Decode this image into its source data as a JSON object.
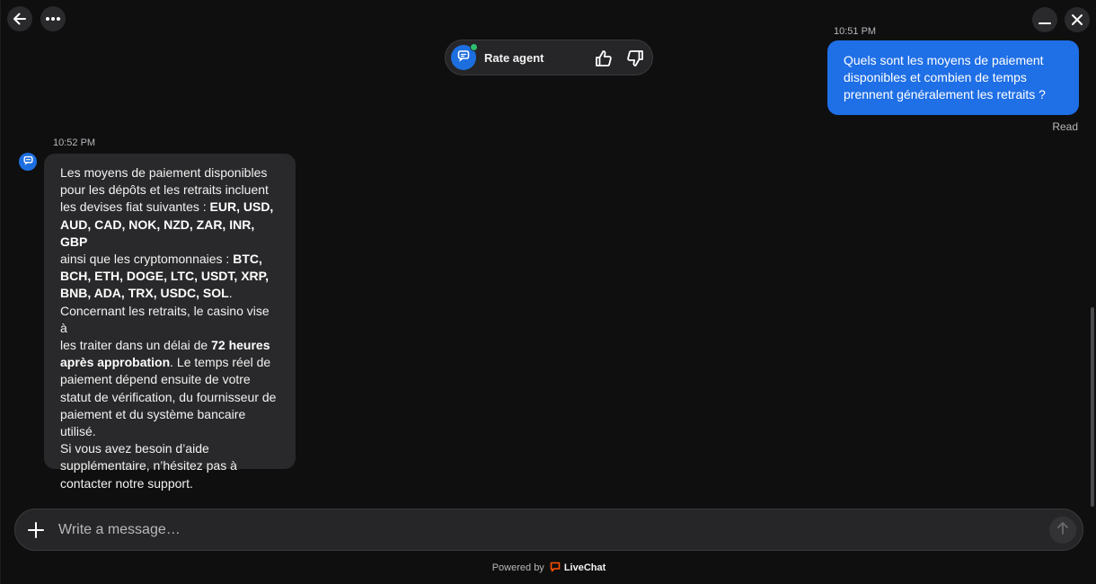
{
  "header": {
    "rate_agent": {
      "label": "Rate agent"
    }
  },
  "messages": [
    {
      "sender": "user",
      "time": "10:51 PM",
      "lines": [
        "Quels sont les moyens de paiement",
        "disponibles et combien de temps",
        "prennent généralement les retraits ?"
      ],
      "status": "Read"
    },
    {
      "sender": "agent",
      "time": "10:52 PM",
      "text": {
        "l1": "Les moyens de paiement disponibles",
        "l2": "pour les dépôts et les retraits incluent",
        "l3a": "les devises fiat suivantes : ",
        "l3b": "EUR, USD,",
        "l4": "AUD, CAD, NOK, NZD, ZAR, INR, GBP",
        "l5a": "ainsi que les cryptomonnaies : ",
        "l5b": "BTC,",
        "l6": "BCH, ETH, DOGE, LTC, USDT, XRP,",
        "l7a": "BNB, ADA, TRX, USDC, SOL",
        "l7b": ".",
        "l8": "Concernant les retraits, le casino vise à",
        "l9a": "les traiter dans un délai de ",
        "l9b": "72 heures",
        "l10a": "après approbation",
        "l10b": ". Le temps réel de",
        "l11": "paiement dépend ensuite de votre",
        "l12": "statut de vérification, du fournisseur de",
        "l13": "paiement et du système bancaire",
        "l14": "utilisé.",
        "l15": "Si vous avez besoin d’aide",
        "l16": "supplémentaire, n’hésitez pas à",
        "l17": "contacter notre support."
      }
    }
  ],
  "composer": {
    "placeholder": "Write a message…"
  },
  "footer": {
    "powered_by": "Powered by",
    "brand": "LiveChat"
  },
  "colors": {
    "background": "#0f0f10",
    "user_bubble": "#1f6fe6",
    "agent_bubble": "#29292b",
    "accent": "#1d6fe0",
    "online": "#2fbf71",
    "brand_orange": "#ff5100"
  },
  "icons": {
    "back": "back-arrow-icon",
    "more": "more-dots-icon",
    "minimize": "minimize-icon",
    "close": "close-icon",
    "thumbs_up": "thumbs-up-icon",
    "thumbs_down": "thumbs-down-icon",
    "plus": "plus-icon",
    "send": "send-arrow-icon",
    "agent": "chat-bubble-icon"
  }
}
